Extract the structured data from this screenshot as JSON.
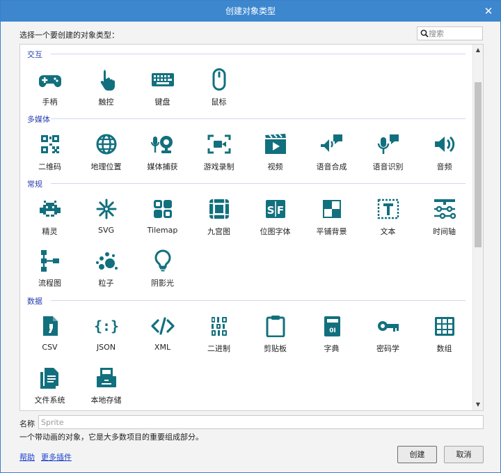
{
  "window": {
    "title": "创建对象类型",
    "close_glyph": "✕"
  },
  "prompt": "选择一个要创建的对象类型：",
  "search": {
    "placeholder": "搜索",
    "value": "",
    "icon": "search-icon"
  },
  "categories": [
    {
      "title": "交互",
      "items": [
        {
          "label": "手柄",
          "icon": "gamepad-icon"
        },
        {
          "label": "触控",
          "icon": "touch-icon"
        },
        {
          "label": "键盘",
          "icon": "keyboard-icon"
        },
        {
          "label": "鼠标",
          "icon": "mouse-icon"
        }
      ]
    },
    {
      "title": "多媒体",
      "items": [
        {
          "label": "二维码",
          "icon": "qr-code-icon"
        },
        {
          "label": "地理位置",
          "icon": "globe-icon"
        },
        {
          "label": "媒体捕获",
          "icon": "webcam-icon"
        },
        {
          "label": "游戏录制",
          "icon": "screen-record-icon"
        },
        {
          "label": "视频",
          "icon": "video-icon"
        },
        {
          "label": "语音合成",
          "icon": "speech-synthesis-icon"
        },
        {
          "label": "语音识别",
          "icon": "speech-recognition-icon"
        },
        {
          "label": "音频",
          "icon": "audio-icon"
        }
      ]
    },
    {
      "title": "常规",
      "items": [
        {
          "label": "精灵",
          "icon": "sprite-icon"
        },
        {
          "label": "SVG",
          "icon": "svg-icon"
        },
        {
          "label": "Tilemap",
          "icon": "tilemap-icon"
        },
        {
          "label": "九宫图",
          "icon": "nine-patch-icon"
        },
        {
          "label": "位图字体",
          "icon": "sprite-font-icon"
        },
        {
          "label": "平铺背景",
          "icon": "tiled-background-icon"
        },
        {
          "label": "文本",
          "icon": "text-icon"
        },
        {
          "label": "时间轴",
          "icon": "timeline-icon"
        },
        {
          "label": "流程图",
          "icon": "flowchart-icon"
        },
        {
          "label": "粒子",
          "icon": "particles-icon"
        },
        {
          "label": "阴影光",
          "icon": "shadow-light-icon"
        }
      ]
    },
    {
      "title": "数据",
      "items": [
        {
          "label": "CSV",
          "icon": "csv-icon"
        },
        {
          "label": "JSON",
          "icon": "json-icon"
        },
        {
          "label": "XML",
          "icon": "xml-icon"
        },
        {
          "label": "二进制",
          "icon": "binary-icon"
        },
        {
          "label": "剪贴板",
          "icon": "clipboard-icon"
        },
        {
          "label": "字典",
          "icon": "dictionary-icon"
        },
        {
          "label": "密码学",
          "icon": "cryptography-icon"
        },
        {
          "label": "数组",
          "icon": "array-icon"
        },
        {
          "label": "文件系统",
          "icon": "file-system-icon"
        },
        {
          "label": "本地存储",
          "icon": "local-storage-icon"
        }
      ]
    }
  ],
  "name_field": {
    "label": "名称",
    "placeholder": "Sprite",
    "value": ""
  },
  "description": "一个带动画的对象，它是大多数项目的重要组成部分。",
  "links": {
    "help": "帮助",
    "more_plugins": "更多插件"
  },
  "buttons": {
    "create": "创建",
    "cancel": "取消"
  },
  "colors": {
    "icon_teal": "#12707e",
    "titlebar_blue": "#3d87cf",
    "category_blue": "#2a3fb0"
  }
}
